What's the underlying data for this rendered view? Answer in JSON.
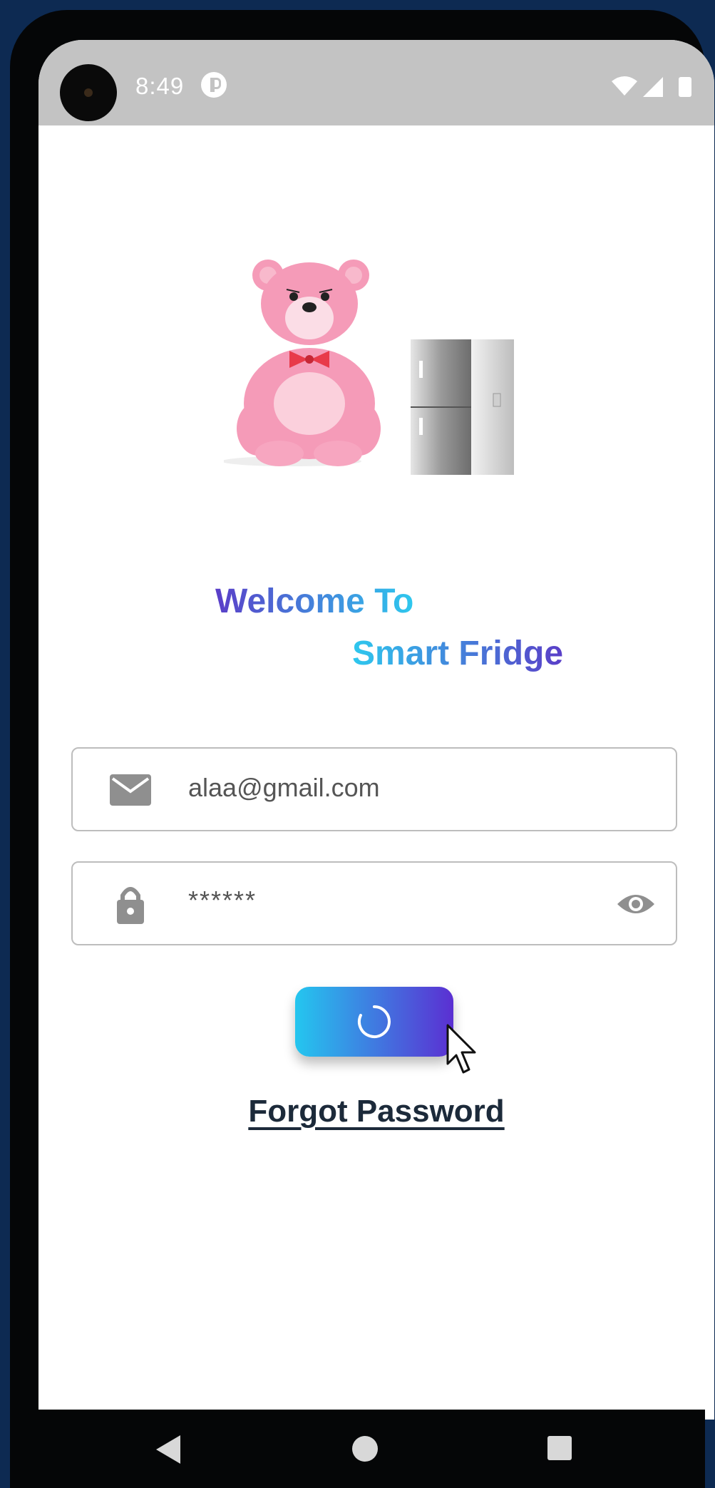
{
  "status_bar": {
    "time": "8:49",
    "icons": [
      "notification-icon",
      "wifi-icon",
      "signal-icon",
      "battery-icon"
    ]
  },
  "illustration": {
    "icons": [
      "pink-bear-illustration",
      "fridge-illustration"
    ]
  },
  "welcome": {
    "line1": "Welcome To",
    "line2": "Smart Fridge"
  },
  "email_field": {
    "icon": "mail-icon",
    "value": "alaa@gmail.com"
  },
  "password_field": {
    "icon": "lock-icon",
    "value": "******",
    "toggle_icon": "eye-icon"
  },
  "login_button": {
    "state": "loading",
    "icon": "spinner-icon"
  },
  "forgot_password": {
    "label": "Forgot Password"
  },
  "navigation_bar": {
    "icons": [
      "back-icon",
      "home-icon",
      "recents-icon"
    ]
  },
  "colors": {
    "gradient_start": "#24c6ef",
    "gradient_end": "#5b2fd2",
    "status_bar": "#c3c3c3",
    "bezel": "#050607",
    "background_outer": "#0d2a52"
  }
}
